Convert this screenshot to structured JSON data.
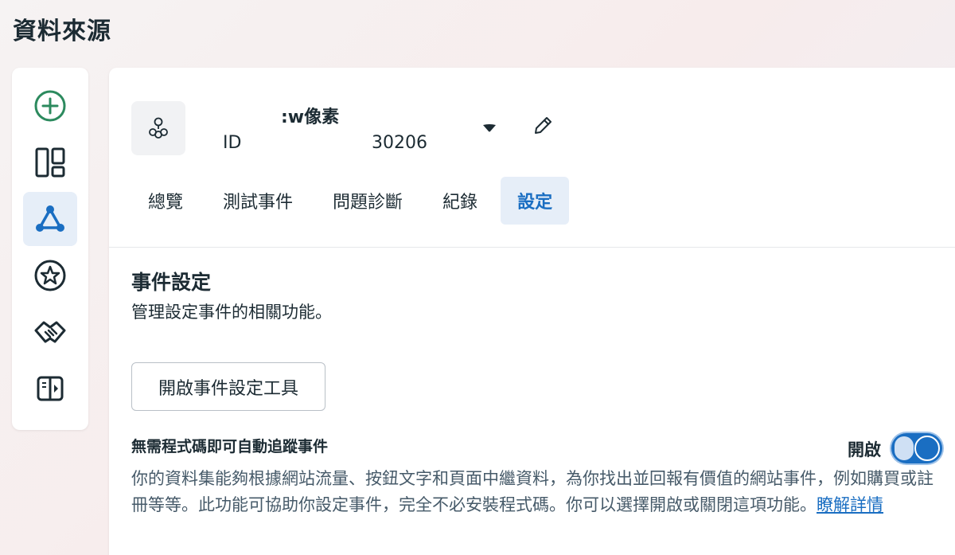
{
  "page": {
    "title": "資料來源"
  },
  "sidebar": {
    "items": [
      {
        "icon": "add-circle-icon",
        "active": false
      },
      {
        "icon": "layout-panels-icon",
        "active": false
      },
      {
        "icon": "network-triangle-icon",
        "active": true
      },
      {
        "icon": "star-circle-icon",
        "active": false
      },
      {
        "icon": "handshake-icon",
        "active": false
      },
      {
        "icon": "sidebar-toggle-icon",
        "active": false
      }
    ]
  },
  "pixel": {
    "icon": "pixel-cluster-icon",
    "name": ":w像素",
    "id_label": "ID",
    "id_value": "30206"
  },
  "tabs": [
    {
      "label": "總覽",
      "active": false
    },
    {
      "label": "測試事件",
      "active": false
    },
    {
      "label": "問題診斷",
      "active": false
    },
    {
      "label": "紀錄",
      "active": false
    },
    {
      "label": "設定",
      "active": true
    }
  ],
  "event_settings": {
    "title": "事件設定",
    "description": "管理設定事件的相關功能。",
    "open_tool_button": "開啟事件設定工具"
  },
  "auto_tracking": {
    "title": "無需程式碼即可自動追蹤事件",
    "toggle_label": "開啟",
    "toggle_on": true,
    "description": "你的資料集能夠根據網站流量、按鈕文字和頁面中繼資料，為你找出並回報有價值的網站事件，例如購買或註冊等等。此功能可協助你設定事件，完全不必安裝程式碼。你可以選擇開啟或關閉這項功能。",
    "learn_more": "瞭解詳情"
  },
  "colors": {
    "accent": "#1a6ec2",
    "active_bg": "#e6eef8",
    "green_icon": "#2c8a5e",
    "text": "#1c2b33"
  }
}
